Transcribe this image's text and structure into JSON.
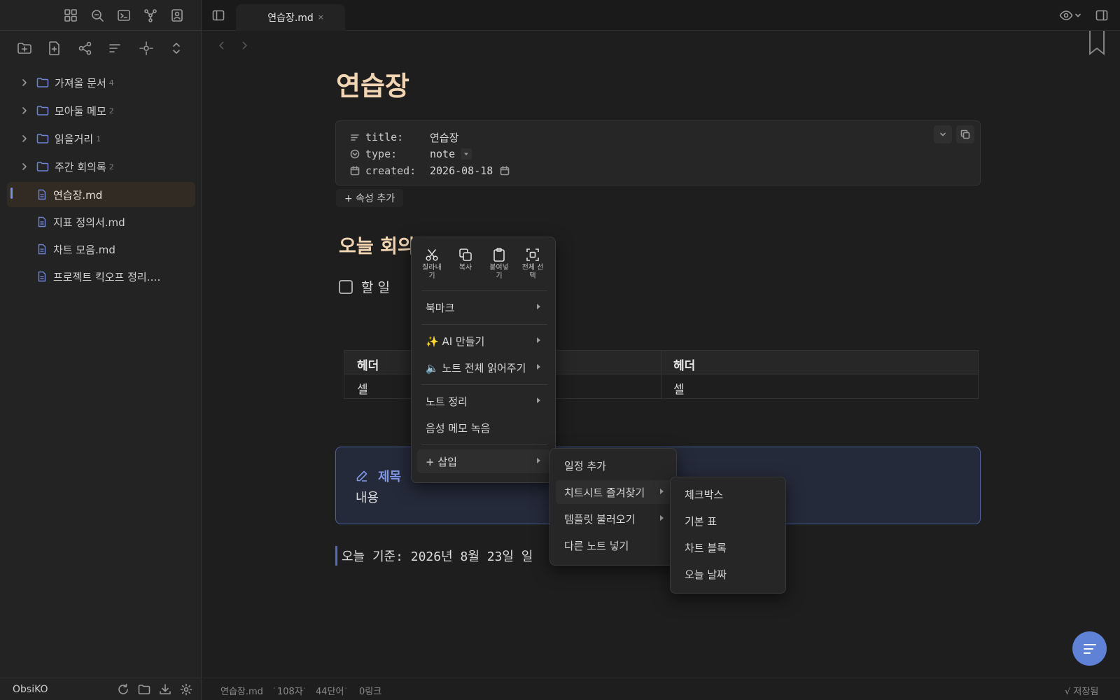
{
  "app": {
    "vault_name": "ObsiKO",
    "accent": "#7b8fe0",
    "heading_color": "#f1d5b3",
    "callout_color": "#7f97e6"
  },
  "tab": {
    "title": "연습장.md",
    "close": "×"
  },
  "sidebar": {
    "ribbon_icons": [
      "dashboard-icon",
      "search-icon",
      "terminal-icon",
      "graph-icon",
      "profile-icon"
    ],
    "toolbar_icons": [
      "new-folder-icon",
      "new-note-icon",
      "tree-icon",
      "sort-icon",
      "locate-icon",
      "collapse-icon"
    ],
    "folders": [
      {
        "label": "가져올 문서",
        "count": "4"
      },
      {
        "label": "모아둘 메모",
        "count": "2"
      },
      {
        "label": "읽을거리",
        "count": "1"
      },
      {
        "label": "주간 회의록",
        "count": "2"
      }
    ],
    "files": [
      {
        "label": "연습장.md"
      },
      {
        "label": "지표 정의서.md"
      },
      {
        "label": "차트 모음.md"
      },
      {
        "label": "프로젝트 킥오프 정리.…"
      }
    ]
  },
  "note": {
    "title": "연습장",
    "properties": [
      {
        "key": "title:",
        "value": "연습장"
      },
      {
        "key": "type:",
        "value": "note"
      },
      {
        "key": "created:",
        "value": "2026-08-18"
      }
    ],
    "add_property": "+ 속성 추가",
    "heading": "오늘 회의",
    "task": "할 일",
    "table": {
      "headers": [
        "헤더",
        "헤더"
      ],
      "cells": [
        "셀",
        "셀"
      ]
    },
    "callout": {
      "title": "제목",
      "body": "내용"
    },
    "today_line": "오늘 기준: 2026년 8월 23일 일"
  },
  "context_menu": {
    "quick_actions": [
      {
        "label": "잘라내\n기",
        "icon": "scissors-icon"
      },
      {
        "label": "복사",
        "icon": "copy-icon"
      },
      {
        "label": "붙여넣\n기",
        "icon": "clipboard-icon"
      },
      {
        "label": "전체 선\n택",
        "icon": "select-all-icon"
      }
    ],
    "items": {
      "bookmark": "북마크",
      "ai": "✨ AI 만들기",
      "read_aloud": "🔈 노트 전체 읽어주기",
      "organize": "노트 정리",
      "record": "음성 메모 녹음",
      "insert": "+  삽입"
    }
  },
  "insert_submenu": [
    "일정 추가",
    "치트시트 즐겨찾기",
    "템플릿 불러오기",
    "다른 노트 넣기"
  ],
  "cheatsheet_submenu": [
    "체크박스",
    "기본 표",
    "차트 블록",
    "오늘 날짜"
  ],
  "status": {
    "file": "연습장.md",
    "chars": "108자",
    "words": "44단어",
    "links": "0링크",
    "saved": "√ 저장됨"
  }
}
